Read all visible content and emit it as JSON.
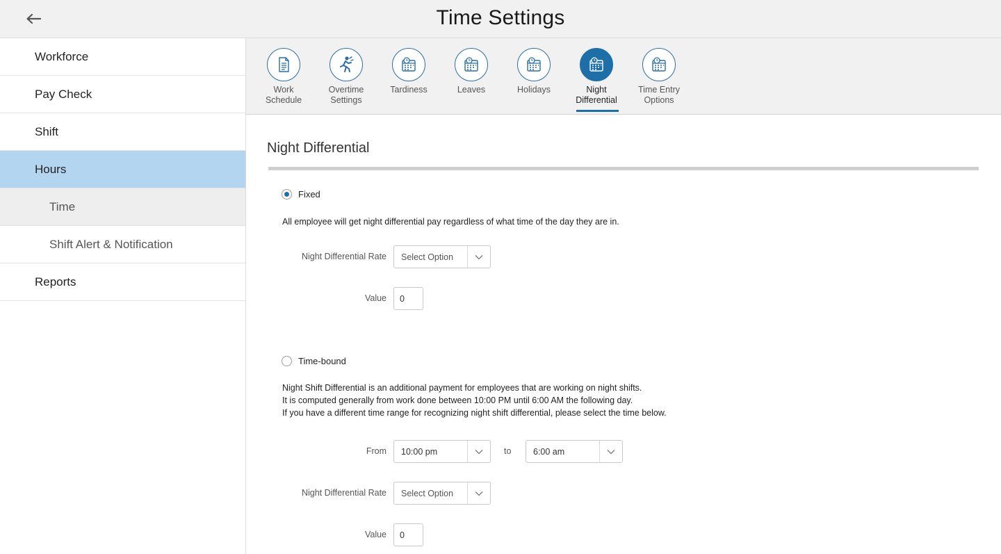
{
  "header": {
    "title": "Time Settings",
    "back_icon": "arrow-left-icon"
  },
  "sidebar": {
    "items": [
      {
        "label": "Workforce"
      },
      {
        "label": "Pay Check"
      },
      {
        "label": "Shift"
      },
      {
        "label": "Hours"
      },
      {
        "label": "Time"
      },
      {
        "label": "Shift Alert & Notification"
      },
      {
        "label": "Reports"
      }
    ]
  },
  "tabs": [
    {
      "line1": "Work",
      "line2": "Schedule",
      "icon": "document-icon"
    },
    {
      "line1": "Overtime",
      "line2": "Settings",
      "icon": "running-person-icon"
    },
    {
      "line1": "Tardiness",
      "line2": "",
      "icon": "calendar-clock-icon"
    },
    {
      "line1": "Leaves",
      "line2": "",
      "icon": "calendar-clock-icon"
    },
    {
      "line1": "Holidays",
      "line2": "",
      "icon": "calendar-clock-icon"
    },
    {
      "line1": "Night",
      "line2": "Differential",
      "icon": "calendar-clock-icon"
    },
    {
      "line1": "Time Entry",
      "line2": "Options",
      "icon": "calendar-clock-icon"
    }
  ],
  "selected_tab": "Night Differential",
  "section": {
    "title": "Night Differential",
    "fixed": {
      "label": "Fixed",
      "selected": true,
      "description": "All employee will get night differential pay regardless of what time of the day they are in.",
      "rate_label": "Night Differential Rate",
      "rate_value": "Select Option",
      "value_label": "Value",
      "value": "0"
    },
    "timebound": {
      "label": "Time-bound",
      "selected": false,
      "description_lines": [
        "Night Shift Differential is an additional payment for employees that are working on night shifts.",
        "It is computed generally from work done between 10:00 PM until 6:00 AM the following day.",
        "If you have a different time range for recognizing night shift differential, please select the time below."
      ],
      "from_label": "From",
      "from_value": "10:00 pm",
      "to_label": "to",
      "to_value": "6:00 am",
      "rate_label": "Night Differential Rate",
      "rate_value": "Select Option",
      "value_label": "Value",
      "value": "0"
    }
  },
  "colors": {
    "accent": "#1e6fa8",
    "sidebar_active": "#b3d5ef",
    "header_bg": "#f1f1f1"
  }
}
